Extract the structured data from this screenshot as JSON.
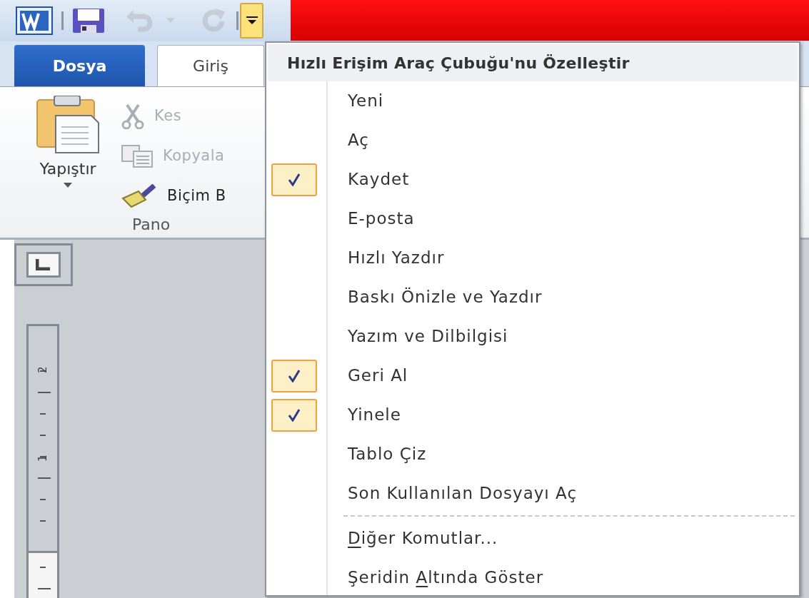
{
  "quick_access_toolbar": {
    "buttons": [
      {
        "kind": "app"
      },
      {
        "kind": "save"
      },
      {
        "kind": "undo",
        "disabled": true
      },
      {
        "kind": "undo_menu",
        "disabled": true
      },
      {
        "kind": "redo",
        "disabled": true
      },
      {
        "kind": "customize",
        "pressed": true
      }
    ]
  },
  "tabs": [
    {
      "label": "Dosya",
      "kind": "file",
      "selected": false
    },
    {
      "label": "Giriş",
      "kind": "tab",
      "selected": true
    }
  ],
  "ribbon": {
    "paste": {
      "label": "Yapıştır"
    },
    "commands": [
      {
        "label": "Kes",
        "kind": "cut",
        "disabled": true
      },
      {
        "label": "Kopyala",
        "kind": "copy",
        "disabled": true
      },
      {
        "label": "Biçim B",
        "kind": "format_painter",
        "disabled": false
      }
    ],
    "group_label": "Pano"
  },
  "vertical_ruler": {
    "labels": [
      "2",
      "1"
    ]
  },
  "menu": {
    "title": "Hızlı Erişim Araç Çubuğu'nu Özelleştir",
    "items": [
      {
        "label": "Yeni",
        "checked": false
      },
      {
        "label": "Aç",
        "checked": false
      },
      {
        "label": "Kaydet",
        "checked": true
      },
      {
        "label": "E-posta",
        "checked": false
      },
      {
        "label": "Hızlı Yazdır",
        "checked": false
      },
      {
        "label": "Baskı Önizle ve Yazdır",
        "checked": false
      },
      {
        "label": "Yazım ve Dilbilgisi",
        "checked": false
      },
      {
        "label": "Geri Al",
        "checked": true
      },
      {
        "label": "Yinele",
        "checked": true
      },
      {
        "label": "Tablo Çiz",
        "checked": false
      },
      {
        "label": "Son Kullanılan Dosyayı Aç",
        "checked": false
      }
    ],
    "more": [
      {
        "access_key": "D",
        "label_end": "iğer Komutlar..."
      },
      {
        "label_start": "Şeridin ",
        "access_key": "A",
        "label_end": "ltında Göster"
      }
    ]
  }
}
